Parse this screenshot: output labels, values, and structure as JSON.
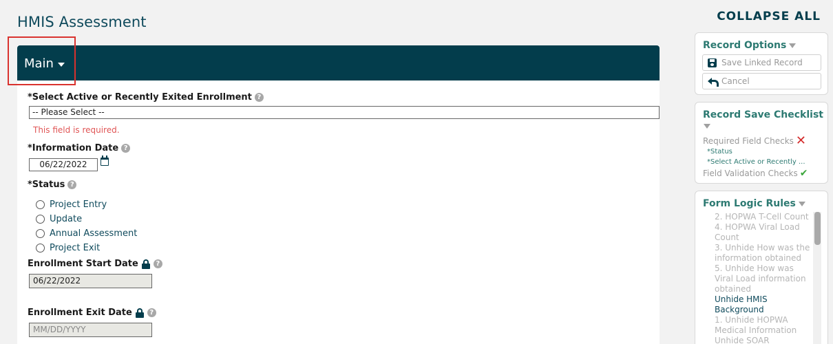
{
  "page_title": "HMIS Assessment",
  "section": {
    "tab_label": "Main"
  },
  "fields": {
    "enrollment": {
      "label": "*Select Active or Recently Exited Enrollment",
      "value": "-- Please Select --",
      "error": "This field is required."
    },
    "info_date": {
      "label": "*Information Date",
      "value": "06/22/2022"
    },
    "status": {
      "label": "*Status",
      "options": [
        "Project Entry",
        "Update",
        "Annual Assessment",
        "Project Exit"
      ]
    },
    "start_date": {
      "label": "Enrollment Start Date",
      "value": "06/22/2022"
    },
    "exit_date": {
      "label": "Enrollment Exit Date",
      "placeholder": "MM/DD/YYYY"
    }
  },
  "sidebar": {
    "collapse_all": "COLLAPSE ALL",
    "record_options": {
      "title": "Record Options",
      "save_label": "Save Linked Record",
      "cancel_label": "Cancel"
    },
    "checklist": {
      "title": "Record Save Checklist",
      "required_label": "Required Field Checks",
      "required_items": [
        "*Status",
        "*Select Active or Recently ..."
      ],
      "validation_label": "Field Validation Checks"
    },
    "logic_rules": {
      "title": "Form Logic Rules",
      "items": [
        {
          "text": "2. HOPWA T-Cell Count",
          "active": false
        },
        {
          "text": "4. HOPWA Viral Load Count",
          "active": false
        },
        {
          "text": "3. Unhide How was the information obtained",
          "active": false
        },
        {
          "text": "5. Unhide How was Viral Load information obtained",
          "active": false
        },
        {
          "text": "Unhide HMIS Background",
          "active": true
        },
        {
          "text": "1. Unhide HOPWA Medical Information",
          "active": false
        },
        {
          "text": "Unhide SOAR",
          "active": false
        }
      ]
    }
  }
}
